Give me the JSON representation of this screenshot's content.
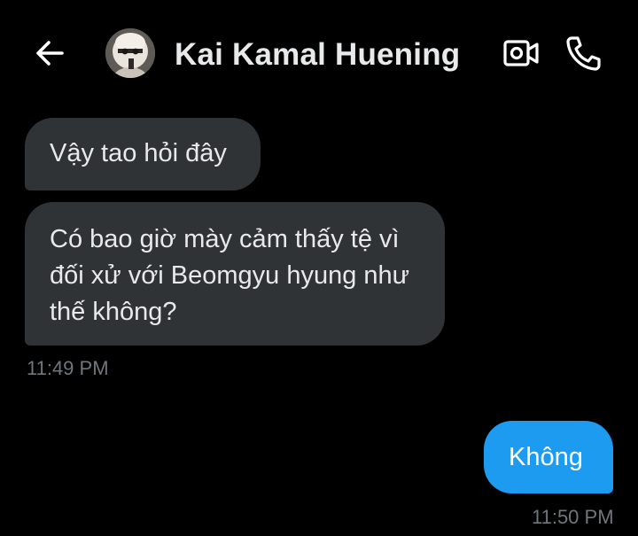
{
  "header": {
    "contact_name": "Kai Kamal Huening"
  },
  "messages": [
    {
      "direction": "incoming",
      "text": "Vậy tao hỏi đây"
    },
    {
      "direction": "incoming",
      "text": "Có bao giờ mày cảm thấy tệ vì đối xử với Beomgyu hyung như thế không?"
    },
    {
      "direction": "outgoing",
      "text": "Không"
    }
  ],
  "timestamps": {
    "incoming_group": "11:49 PM",
    "outgoing_group": "11:50 PM"
  },
  "icons": {
    "back": "back-arrow-icon",
    "video": "video-camera-icon",
    "call": "phone-icon"
  },
  "colors": {
    "background": "#000000",
    "incoming_bubble": "#2f3336",
    "outgoing_bubble": "#1d9bf0",
    "timestamp": "#71767b",
    "text": "#e7e9ea"
  }
}
